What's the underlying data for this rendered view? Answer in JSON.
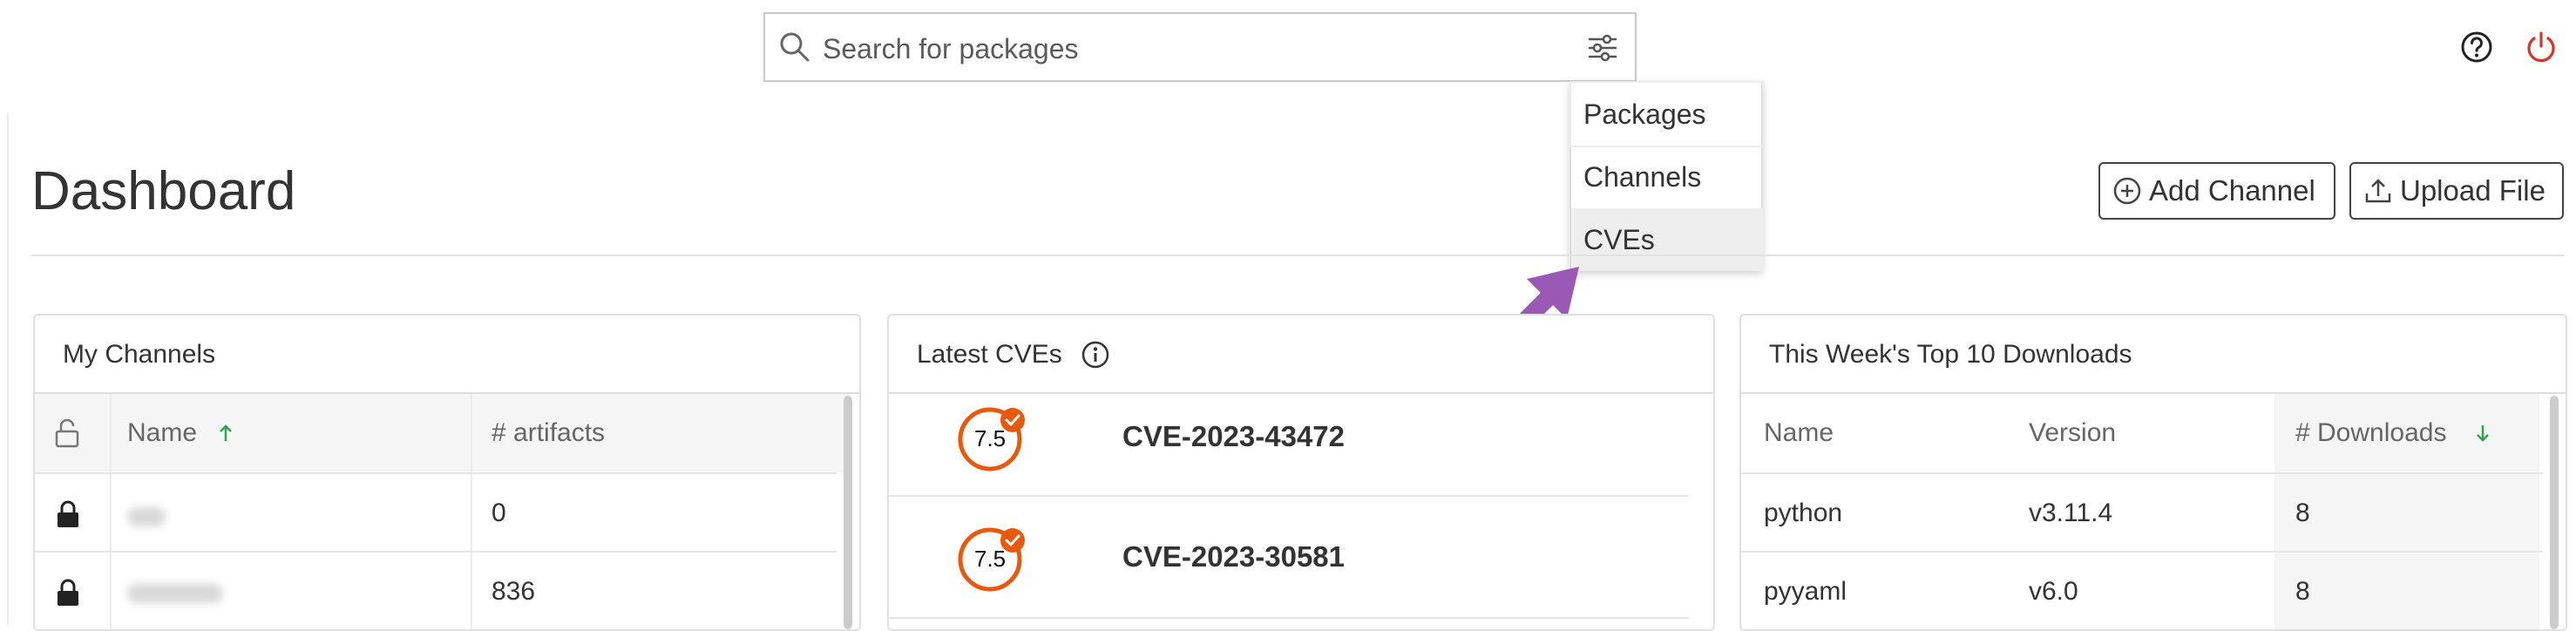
{
  "search": {
    "placeholder": "Search for packages"
  },
  "search_types": [
    {
      "label": "Packages"
    },
    {
      "label": "Channels"
    },
    {
      "label": "CVEs"
    }
  ],
  "page": {
    "title": "Dashboard"
  },
  "actions": {
    "add_channel": "Add Channel",
    "upload_file": "Upload File"
  },
  "my_channels": {
    "title": "My Channels",
    "columns": {
      "name": "Name",
      "artifacts": "# artifacts"
    },
    "rows": [
      {
        "artifacts": "0"
      },
      {
        "artifacts": "836"
      }
    ]
  },
  "latest_cves": {
    "title": "Latest CVEs",
    "items": [
      {
        "score": "7.5",
        "id": "CVE-2023-43472"
      },
      {
        "score": "7.5",
        "id": "CVE-2023-30581"
      }
    ]
  },
  "top_downloads": {
    "title": "This Week's Top 10 Downloads",
    "columns": {
      "name": "Name",
      "version": "Version",
      "downloads": "# Downloads"
    },
    "rows": [
      {
        "name": "python",
        "version": "v3.11.4",
        "downloads": "8"
      },
      {
        "name": "pyyaml",
        "version": "v6.0",
        "downloads": "8"
      }
    ]
  },
  "colors": {
    "accent_purple": "#9b59b6",
    "severity_orange": "#e8590c",
    "sort_green": "#2da44e",
    "power_red": "#d9342b"
  }
}
